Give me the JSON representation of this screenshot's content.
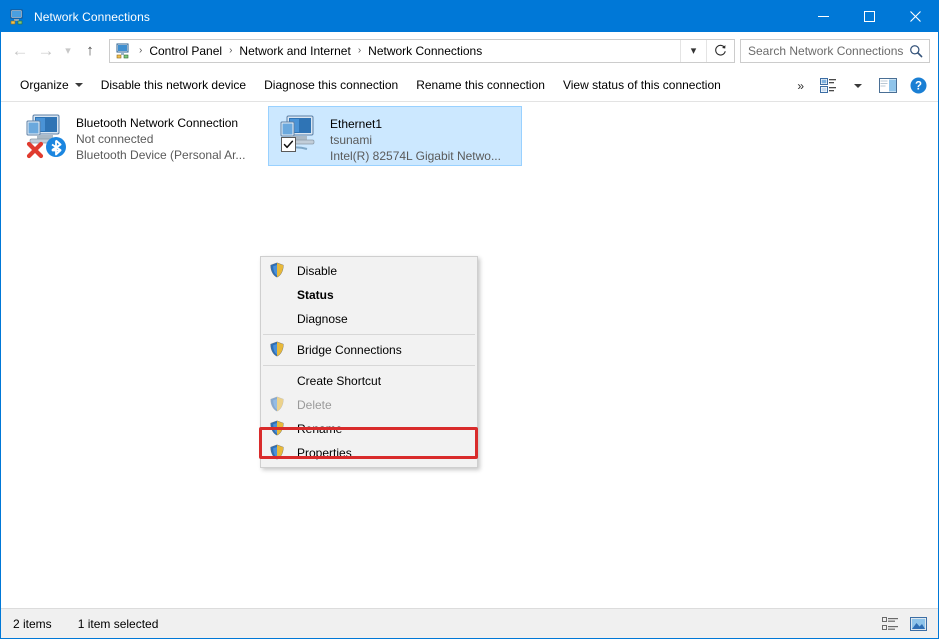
{
  "window": {
    "title": "Network Connections",
    "icon": "network-connections-icon",
    "controls": {
      "minimize": "minimize-button",
      "maximize": "maximize-button",
      "close": "close-button"
    }
  },
  "navbar": {
    "back": "back-arrow-icon",
    "forward": "forward-arrow-icon",
    "recent": "recent-locations-icon",
    "up": "up-arrow-icon",
    "breadcrumb_icon": "network-connections-icon",
    "breadcrumbs": [
      "Control Panel",
      "Network and Internet",
      "Network Connections"
    ],
    "separator": "›",
    "dropdown": "chevron-down-icon",
    "refresh": "refresh-icon",
    "search": {
      "placeholder": "Search Network Connections",
      "value": "",
      "icon": "search-icon"
    }
  },
  "commandbar": {
    "items": [
      {
        "label": "Organize",
        "has_caret": true
      },
      {
        "label": "Disable this network device",
        "has_caret": false
      },
      {
        "label": "Diagnose this connection",
        "has_caret": false
      },
      {
        "label": "Rename this connection",
        "has_caret": false
      },
      {
        "label": "View status of this connection",
        "has_caret": false
      }
    ],
    "overflow": "»",
    "change_view_icon": "change-view-icon",
    "change_view_caret": "chevron-down-icon",
    "preview_pane_icon": "preview-pane-icon",
    "help_icon": "help-icon"
  },
  "connections": [
    {
      "name": "Bluetooth Network Connection",
      "status": "Not connected",
      "device": "Bluetooth Device (Personal Ar...",
      "icon": "bluetooth-adapter-icon",
      "selected": false,
      "checked": false
    },
    {
      "name": "Ethernet1",
      "status": "tsunami",
      "device": "Intel(R) 82574L Gigabit Netwo...",
      "icon": "ethernet-adapter-icon",
      "selected": true,
      "checked": true
    }
  ],
  "context_menu": {
    "items": [
      {
        "label": "Disable",
        "shield": true,
        "bold": false,
        "disabled": false,
        "separator_after": false
      },
      {
        "label": "Status",
        "shield": false,
        "bold": true,
        "disabled": false,
        "separator_after": false
      },
      {
        "label": "Diagnose",
        "shield": false,
        "bold": false,
        "disabled": false,
        "separator_after": true
      },
      {
        "label": "Bridge Connections",
        "shield": true,
        "bold": false,
        "disabled": false,
        "separator_after": true
      },
      {
        "label": "Create Shortcut",
        "shield": false,
        "bold": false,
        "disabled": false,
        "separator_after": false
      },
      {
        "label": "Delete",
        "shield": true,
        "bold": false,
        "disabled": true,
        "separator_after": false
      },
      {
        "label": "Rename",
        "shield": true,
        "bold": false,
        "disabled": false,
        "separator_after": false
      },
      {
        "label": "Properties",
        "shield": true,
        "bold": false,
        "disabled": false,
        "separator_after": false
      }
    ],
    "highlighted_item": "Properties"
  },
  "statusbar": {
    "item_count": "2 items",
    "selection": "1 item selected",
    "details_view_icon": "details-view-icon",
    "large_icons_view_icon": "large-icons-view-icon"
  },
  "colors": {
    "accent": "#0078d7",
    "selection": "#cce8ff",
    "annotation": "#d92b2b",
    "menu_bg": "#f2f2f2"
  }
}
